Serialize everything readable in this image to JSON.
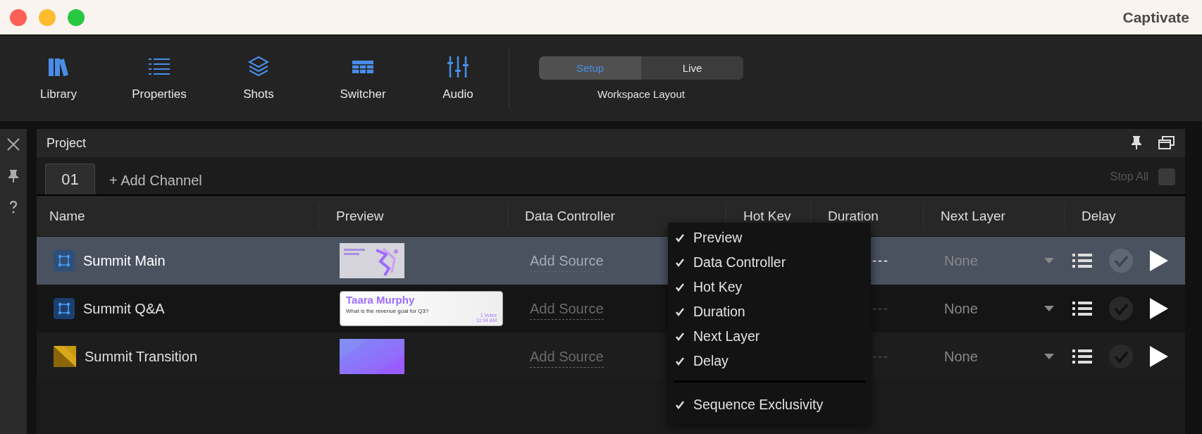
{
  "window": {
    "title": "Captivate"
  },
  "toolbar": {
    "items": [
      {
        "label": "Library",
        "kind": "library"
      },
      {
        "label": "Properties",
        "kind": "properties"
      },
      {
        "label": "Shots",
        "kind": "shots"
      },
      {
        "label": "Switcher",
        "kind": "switcher"
      },
      {
        "label": "Audio",
        "kind": "audio"
      }
    ],
    "workspace": {
      "options": [
        {
          "label": "Setup",
          "selected": true
        },
        {
          "label": "Live",
          "selected": false
        }
      ],
      "caption": "Workspace Layout"
    }
  },
  "panel": {
    "title": "Project",
    "tabs": [
      {
        "label": "01",
        "selected": true
      }
    ],
    "add_channel": "+ Add Channel",
    "stop_all": {
      "label": "Stop All",
      "checked": false
    }
  },
  "table": {
    "columns": [
      "Name",
      "Preview",
      "Data Controller",
      "Hot Kev",
      "Duration",
      "Next Layer",
      "Delay"
    ],
    "rows": [
      {
        "name": "Summit Main",
        "kind": "layer",
        "selected": true,
        "preview": {
          "kind": "slide"
        },
        "data_controller": "Add Source",
        "duration": "---",
        "next_layer": "None"
      },
      {
        "name": "Summit Q&A",
        "kind": "layer",
        "selected": false,
        "preview": {
          "kind": "card",
          "title": "Taara Murphy",
          "question": "What is the revenue goal for Q3?",
          "votes": "1 Votes",
          "time": "11:04 AM"
        },
        "data_controller": "Add Source",
        "duration": "---",
        "next_layer": "None"
      },
      {
        "name": "Summit Transition",
        "kind": "transition",
        "selected": false,
        "preview": {
          "kind": "gradient"
        },
        "data_controller": "Add Source",
        "duration": "---",
        "next_layer": "None"
      }
    ]
  },
  "context_menu": {
    "items": [
      {
        "label": "Preview",
        "checked": true
      },
      {
        "label": "Data Controller",
        "checked": true
      },
      {
        "label": "Hot Key",
        "checked": true
      },
      {
        "label": "Duration",
        "checked": true
      },
      {
        "label": "Next Layer",
        "checked": true
      },
      {
        "label": "Delay",
        "checked": true
      },
      {
        "label": "Sequence Exclusivity",
        "checked": true,
        "separated": true
      }
    ]
  }
}
